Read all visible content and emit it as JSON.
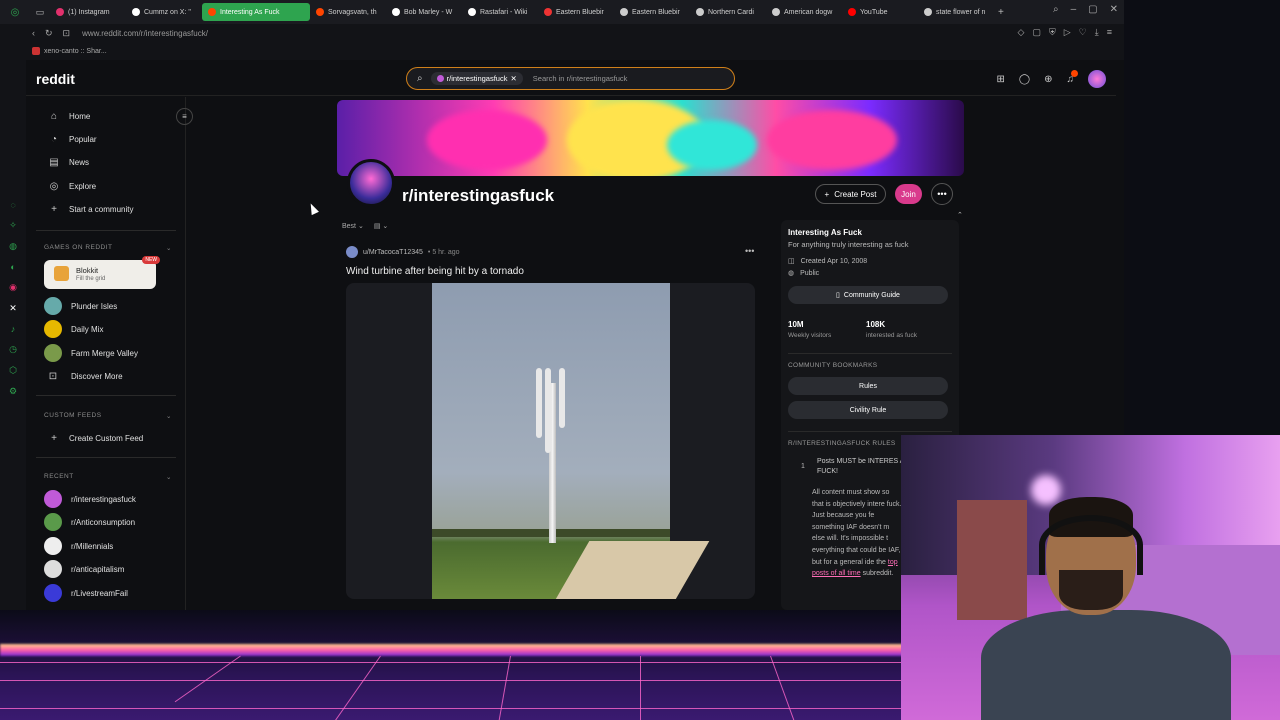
{
  "browser": {
    "tabs": [
      {
        "label": "(1) Instagram",
        "color": "#e1306c"
      },
      {
        "label": "Cummz on X: \"",
        "color": "#ffffff"
      },
      {
        "label": "Interesting As Fuck",
        "color": "#ff4500",
        "active": true
      },
      {
        "label": "Sorvagsvatn, th",
        "color": "#ff4500"
      },
      {
        "label": "Bob Marley - W",
        "color": "#ffffff"
      },
      {
        "label": "Rastafari - Wiki",
        "color": "#ffffff"
      },
      {
        "label": "Eastern Bluebir",
        "color": "#e33"
      },
      {
        "label": "Eastern Bluebir",
        "color": "#ccc"
      },
      {
        "label": "Northern Cardi",
        "color": "#ccc"
      },
      {
        "label": "American dogw",
        "color": "#ccc"
      },
      {
        "label": "YouTube",
        "color": "#ff0000"
      },
      {
        "label": "state flower of n",
        "color": "#ccc"
      }
    ],
    "url": "www.reddit.com/r/interestingasfuck/",
    "bookmark": "xeno-canto :: Shar..."
  },
  "header": {
    "logo": "reddit",
    "search_chip": "r/interestingasfuck",
    "search_placeholder": "Search in r/interestingasfuck"
  },
  "sidebar": {
    "nav": [
      "Home",
      "Popular",
      "News",
      "Explore",
      "Start a community"
    ],
    "games_heading": "GAMES ON REDDIT",
    "blokkit_title": "Blokkit",
    "blokkit_sub": "Fill the grid",
    "new_badge": "NEW",
    "games": [
      "Plunder Isles",
      "Daily Mix",
      "Farm Merge Valley",
      "Discover More"
    ],
    "custom_heading": "CUSTOM FEEDS",
    "create_feed": "Create Custom Feed",
    "recent_heading": "RECENT",
    "recent": [
      "r/interestingasfuck",
      "r/Anticonsumption",
      "r/Millennials",
      "r/anticapitalism",
      "r/LivestreamFail"
    ]
  },
  "subreddit": {
    "name": "r/interestingasfuck",
    "create_post": "Create Post",
    "join": "Join"
  },
  "feed": {
    "sort": "Best",
    "post": {
      "author": "u/MrTacocaT12345",
      "time": "• 5 hr. ago",
      "title": "Wind turbine after being hit by a tornado"
    }
  },
  "panel": {
    "title": "Interesting As Fuck",
    "description": "For anything truly interesting as fuck",
    "created": "Created Apr 10, 2008",
    "visibility": "Public",
    "guide": "Community Guide",
    "stat1_value": "10M",
    "stat1_label": "Weekly visitors",
    "stat2_value": "108K",
    "stat2_label": "interested as fuck",
    "bookmarks_heading": "COMMUNITY BOOKMARKS",
    "bookmark1": "Rules",
    "bookmark2": "Civility Rule",
    "rules_heading": "R/INTERESTINGASFUCK RULES",
    "rule_num": "1",
    "rule_title": "Posts MUST be INTERES AS FUCK!",
    "rule_body": "All content must show so that is objectively intere fuck. Just because you fe something IAF doesn't m else will. It's impossible t everything that could be IAF, but for a general ide the",
    "rule_link": "top posts of all time",
    "rule_tail": "subreddit."
  }
}
